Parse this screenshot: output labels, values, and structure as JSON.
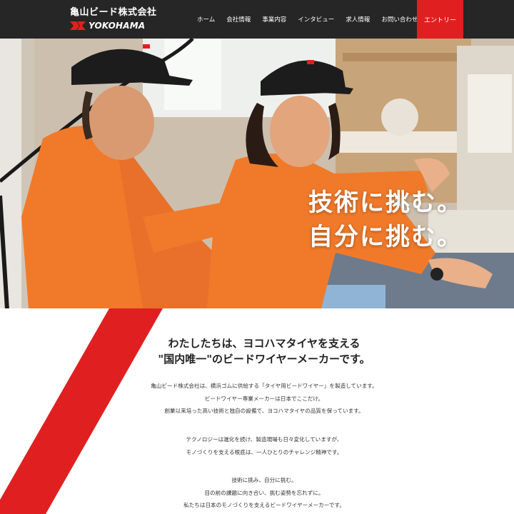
{
  "header": {
    "brand_jp": "亀山ビード株式会社",
    "brand_en": "YOKOHAMA",
    "nav": [
      "ホーム",
      "会社情報",
      "事業内容",
      "インタビュー",
      "求人情報",
      "お問い合わせ"
    ],
    "entry": "エントリー"
  },
  "hero": {
    "catch_line1": "技術に挑む。",
    "catch_line2": "自分に挑む。"
  },
  "main": {
    "lead_line1": "わたしたちは、ヨコハマタイヤを支える",
    "lead_line2": "\"国内唯一\"のビードワイヤーメーカーです。",
    "p1": [
      "亀山ビード株式会社は、横浜ゴムに供給する「タイヤ用ビードワイヤー」を製造しています。",
      "ビードワイヤー専業メーカーは日本でここだけ。",
      "創業以来培った高い技術と独自の設備で、ヨコハマタイヤの品質を保っています。"
    ],
    "p2": [
      "テクノロジーは進化を続け、製造現場も日々変化していますが、",
      "モノづくりを支える根底は、一人ひとりのチャレンジ精神です。"
    ],
    "p3": [
      "技術に挑み、自分に挑む。",
      "目の前の課題に向き合い、挑む姿勢を忘れずに。",
      "私たちは日本のモノづくりを支えるビードワイヤーメーカーです。"
    ]
  },
  "colors": {
    "accent": "#e02020",
    "header_bg": "#141414",
    "uniform": "#f07a2a"
  }
}
